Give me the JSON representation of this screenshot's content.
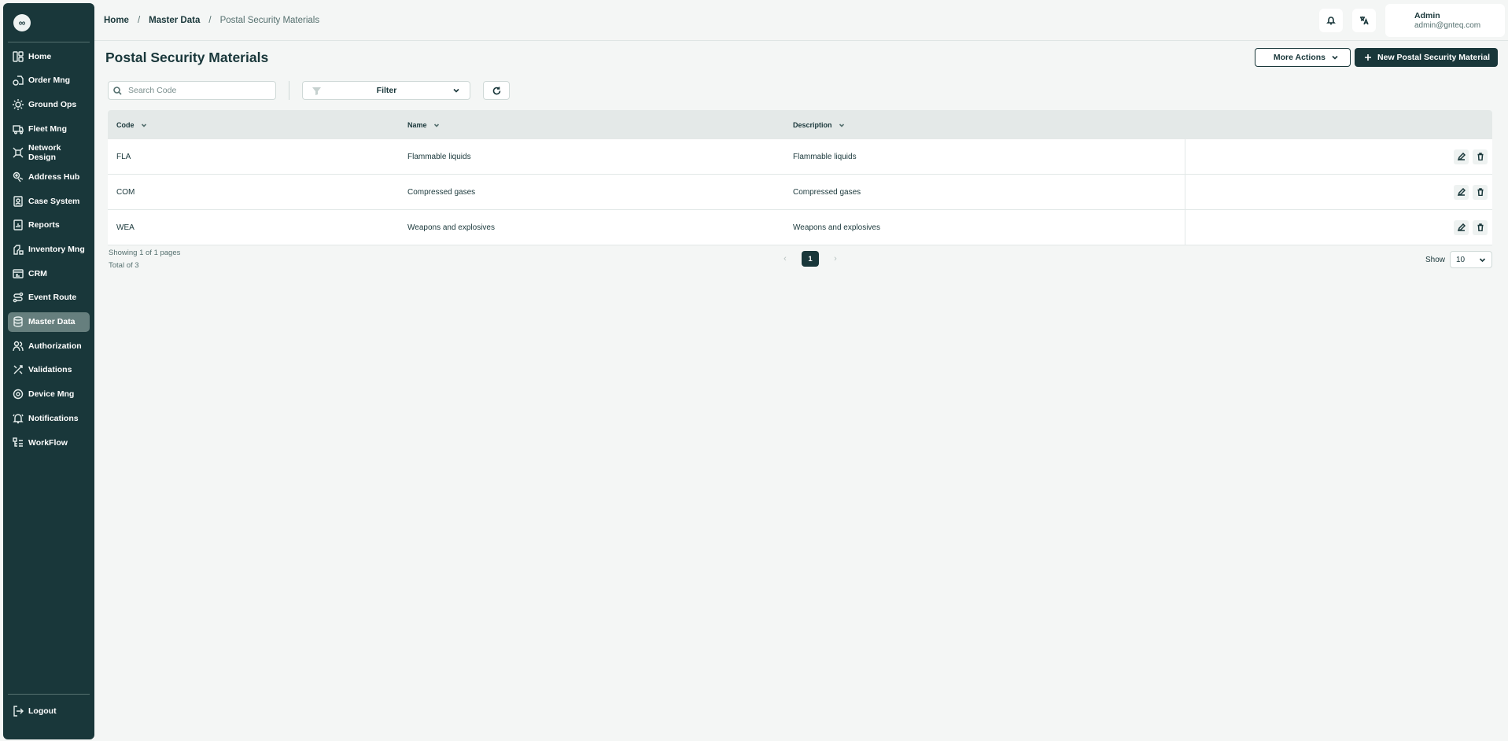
{
  "app": {
    "logo_text": "∞"
  },
  "sidebar": {
    "items": [
      {
        "label": "Home",
        "icon": "home-icon"
      },
      {
        "label": "Order Mng",
        "icon": "order-icon"
      },
      {
        "label": "Ground Ops",
        "icon": "ground-ops-icon"
      },
      {
        "label": "Fleet Mng",
        "icon": "truck-icon"
      },
      {
        "label": "Network Design",
        "icon": "network-icon"
      },
      {
        "label": "Address Hub",
        "icon": "address-icon"
      },
      {
        "label": "Case System",
        "icon": "case-icon"
      },
      {
        "label": "Reports",
        "icon": "reports-icon"
      },
      {
        "label": "Inventory Mng",
        "icon": "inventory-icon"
      },
      {
        "label": "CRM",
        "icon": "crm-icon"
      },
      {
        "label": "Event Route",
        "icon": "route-icon"
      },
      {
        "label": "Master Data",
        "icon": "database-icon",
        "active": true
      },
      {
        "label": "Authorization",
        "icon": "users-icon"
      },
      {
        "label": "Validations",
        "icon": "tools-icon"
      },
      {
        "label": "Device Mng",
        "icon": "device-icon"
      },
      {
        "label": "Notifications",
        "icon": "bell-icon"
      },
      {
        "label": "WorkFlow",
        "icon": "workflow-icon"
      }
    ],
    "logout_label": "Logout"
  },
  "header": {
    "breadcrumb": [
      "Home",
      "Master Data",
      "Postal Security Materials"
    ],
    "separator": "/",
    "user": {
      "name": "Admin",
      "email": "admin@gnteq.com"
    }
  },
  "page": {
    "title": "Postal Security Materials",
    "more_actions_label": "More Actions",
    "new_button_label": "New Postal Security Material"
  },
  "toolbar": {
    "search_placeholder": "Search Code",
    "search_value": "",
    "filter_label": "Filter"
  },
  "table": {
    "columns": [
      "Code",
      "Name",
      "Description"
    ],
    "rows": [
      {
        "code": "FLA",
        "name": "Flammable liquids",
        "description": "Flammable liquids"
      },
      {
        "code": "COM",
        "name": "Compressed gases",
        "description": "Compressed gases"
      },
      {
        "code": "WEA",
        "name": "Weapons and explosives",
        "description": "Weapons and explosives"
      }
    ]
  },
  "pagination": {
    "showing_text": "Showing 1 of 1 pages",
    "total_text": "Total of 3",
    "current_page": "1",
    "prev_glyph": "‹",
    "next_glyph": "›",
    "show_label": "Show",
    "page_size": "10"
  },
  "colors": {
    "sidebar_bg": "#19373a",
    "active_item_bg": "#667f7e",
    "primary": "#19373a",
    "page_bg": "#f4f6f5",
    "table_header_bg": "#e4e9e8"
  }
}
